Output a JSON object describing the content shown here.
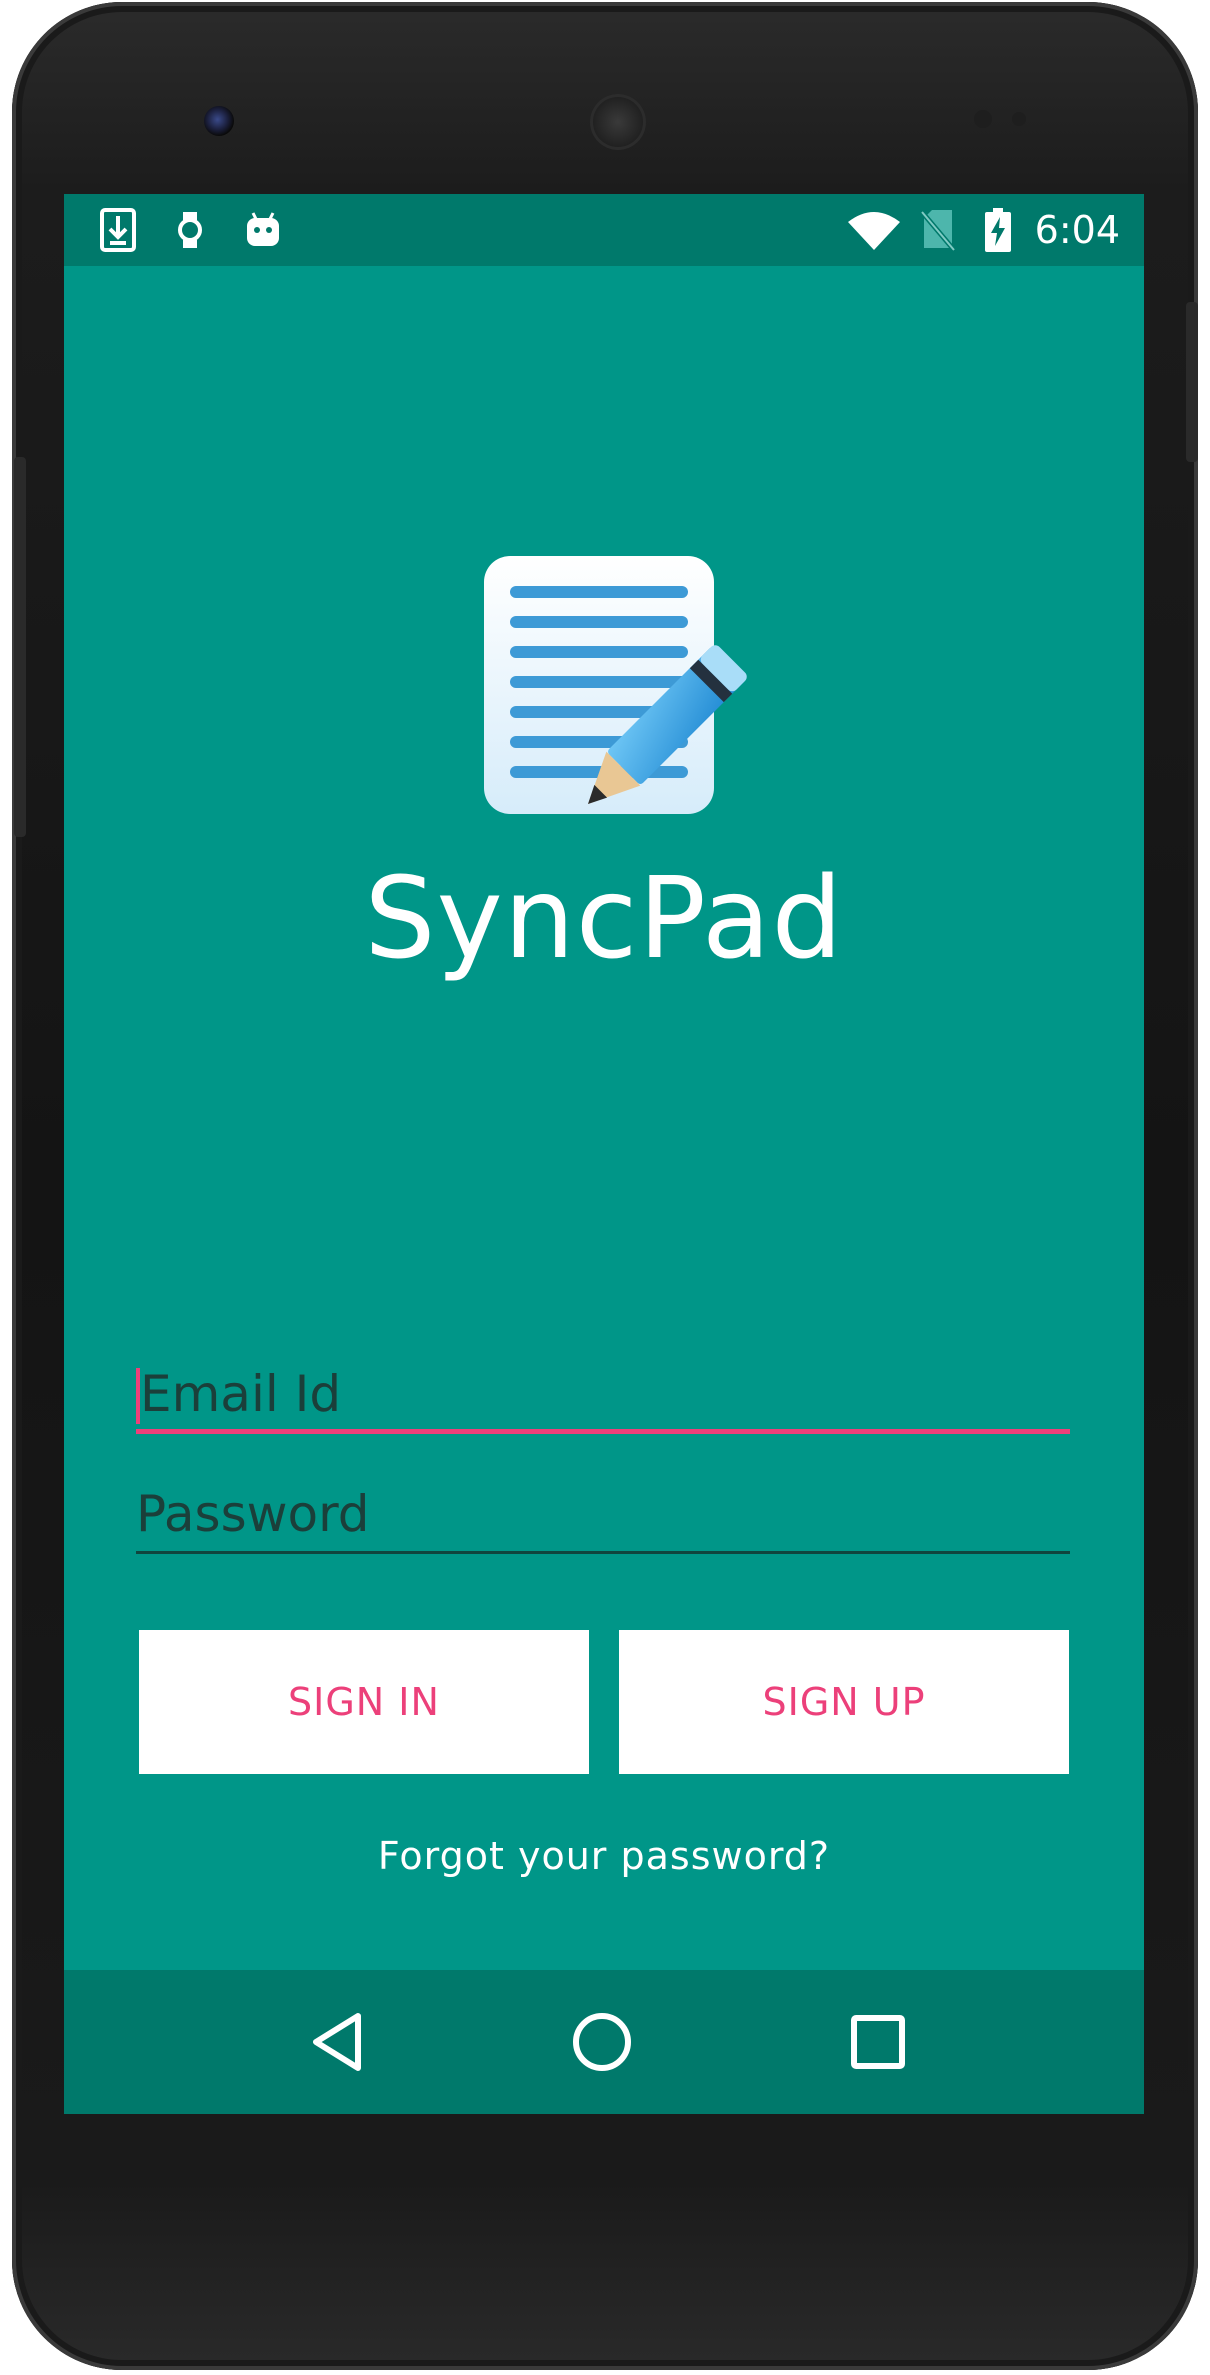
{
  "status_bar": {
    "time": "6:04",
    "left_icons": [
      "download-icon",
      "watch-icon",
      "android-icon"
    ],
    "right_icons": [
      "wifi-icon",
      "no-sim-icon",
      "battery-charging-icon"
    ]
  },
  "app": {
    "title": "SyncPad",
    "logo_icon": "notepad-pencil-icon"
  },
  "form": {
    "email_placeholder": "Email Id",
    "password_placeholder": "Password"
  },
  "buttons": {
    "sign_in": "SIGN IN",
    "sign_up": "SIGN UP"
  },
  "links": {
    "forgot_password": "Forgot your password?"
  },
  "nav_bar": {
    "icons": [
      "back-icon",
      "home-icon",
      "recents-icon"
    ]
  },
  "colors": {
    "primary": "#009688",
    "primary_dark": "#00796b",
    "accent": "#ec407a"
  }
}
